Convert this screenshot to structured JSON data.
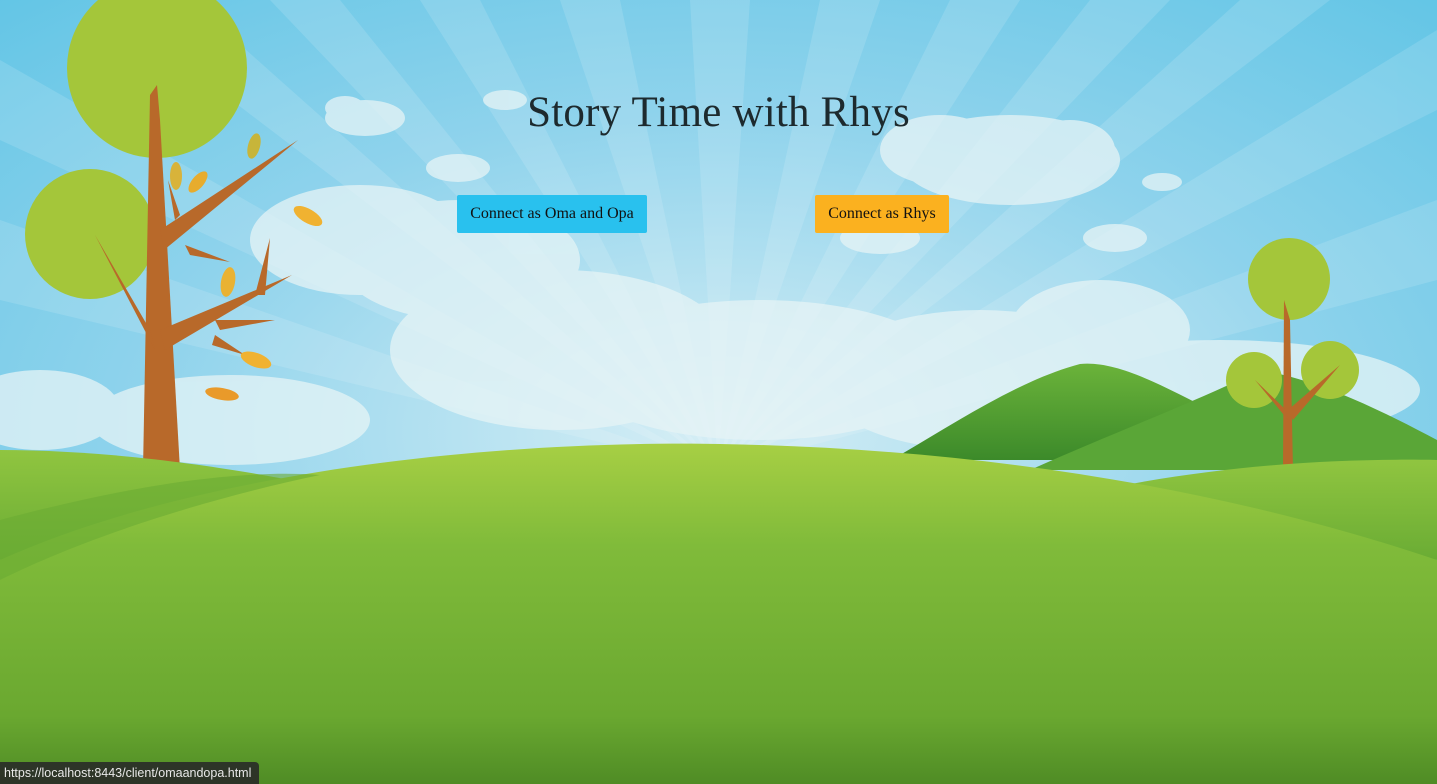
{
  "page": {
    "title": "Story Time with Rhys"
  },
  "buttons": {
    "oma_opa_label": "Connect as Oma and Opa",
    "rhys_label": "Connect as Rhys"
  },
  "status_bar": {
    "url": "https://localhost:8443/client/omaandopa.html"
  },
  "colors": {
    "sky": "#5cc6e6",
    "grass": "#7ab93a",
    "oma_button": "#29c1ee",
    "rhys_button": "#fbb11f",
    "tree_trunk": "#b8692a",
    "tree_leaves": "#a4c63a"
  }
}
